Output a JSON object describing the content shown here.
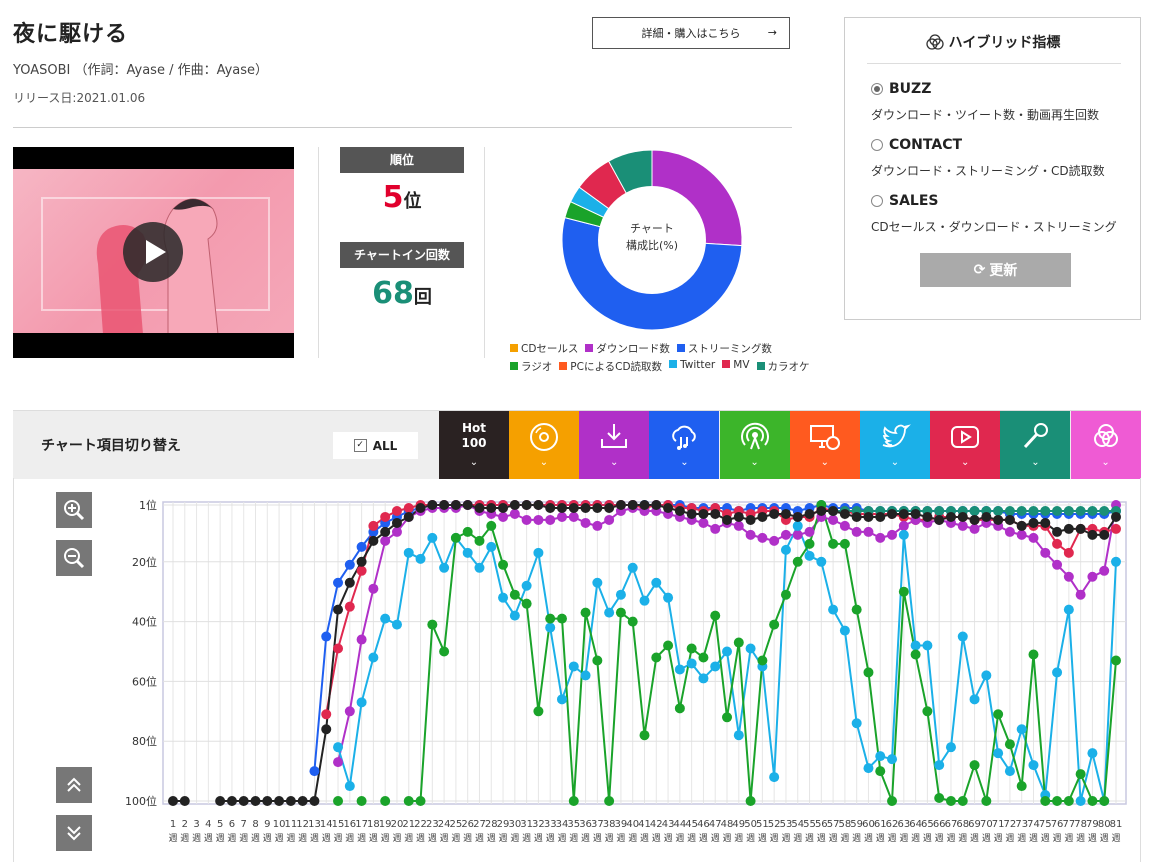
{
  "song": {
    "title": "夜に駆ける",
    "artist": "YOASOBI （作詞：Ayase / 作曲：Ayase）",
    "release": "リリース日:2021.01.06",
    "detail_button": "詳細・購入はこちら",
    "detail_arrow": "→"
  },
  "stats": {
    "rank_label": "順位",
    "rank_value": "5",
    "rank_suffix": "位",
    "chartin_label": "チャートイン回数",
    "chartin_value": "68",
    "chartin_suffix": "回"
  },
  "donut": {
    "center_line1": "チャート",
    "center_line2": "構成比(%)",
    "legend_row1": [
      {
        "label": "CDセールス",
        "color": "#f5a000"
      },
      {
        "label": "ダウンロード数",
        "color": "#b030c8"
      },
      {
        "label": "ストリーミング数",
        "color": "#1f5ff0"
      }
    ],
    "legend_row2": [
      {
        "label": "ラジオ",
        "color": "#1aa32a"
      },
      {
        "label": "PCによるCD読取数",
        "color": "#ff5a1f"
      },
      {
        "label": "Twitter",
        "color": "#1bb0e8"
      },
      {
        "label": "MV",
        "color": "#e0284f"
      },
      {
        "label": "カラオケ",
        "color": "#1a8f77"
      }
    ],
    "slices": [
      {
        "name": "ダウンロード数",
        "value": 26,
        "color": "#b030c8"
      },
      {
        "name": "ストリーミング数",
        "value": 53,
        "color": "#1f5ff0"
      },
      {
        "name": "ラジオ",
        "value": 3,
        "color": "#1aa32a"
      },
      {
        "name": "Twitter",
        "value": 3,
        "color": "#1bb0e8"
      },
      {
        "name": "MV",
        "value": 7,
        "color": "#e0284f"
      },
      {
        "name": "カラオケ",
        "value": 8,
        "color": "#1a8f77"
      }
    ]
  },
  "hybrid": {
    "title": "ハイブリッド指標",
    "options": [
      {
        "label": "BUZZ",
        "desc": "ダウンロード・ツイート数・動画再生回数",
        "selected": true
      },
      {
        "label": "CONTACT",
        "desc": "ダウンロード・ストリーミング・CD読取数",
        "selected": false
      },
      {
        "label": "SALES",
        "desc": "CDセールス・ダウンロード・ストリーミング",
        "selected": false
      }
    ],
    "refresh": "更新"
  },
  "switcher": {
    "title": "チャート項目切り替え",
    "all": "ALL",
    "hot_line1": "Hot",
    "hot_line2": "100",
    "tabs": [
      {
        "icon": "cd-icon",
        "color": "#f5a000"
      },
      {
        "icon": "download-icon",
        "color": "#b030c8"
      },
      {
        "icon": "streaming-icon",
        "color": "#1f5ff0"
      },
      {
        "icon": "radio-icon",
        "color": "#3cb52a"
      },
      {
        "icon": "pc-cd-icon",
        "color": "#ff5a1f"
      },
      {
        "icon": "twitter-icon",
        "color": "#1bb0e8"
      },
      {
        "icon": "video-icon",
        "color": "#e0284f"
      },
      {
        "icon": "karaoke-icon",
        "color": "#1a8f77"
      },
      {
        "icon": "hybrid-icon",
        "color": "#ef5bd4"
      }
    ]
  },
  "chart_data": {
    "type": "line",
    "ylabels": [
      "1位",
      "20位",
      "40位",
      "60位",
      "80位",
      "100位"
    ],
    "yticks": [
      1,
      20,
      40,
      60,
      80,
      100
    ],
    "ylim": [
      1,
      100
    ],
    "x_suffix": "週",
    "x": [
      1,
      2,
      3,
      4,
      5,
      6,
      7,
      8,
      9,
      10,
      11,
      12,
      13,
      14,
      15,
      16,
      17,
      18,
      19,
      20,
      21,
      22,
      23,
      24,
      25,
      26,
      27,
      28,
      29,
      30,
      31,
      32,
      33,
      34,
      35,
      36,
      37,
      38,
      39,
      40,
      41,
      42,
      43,
      44,
      45,
      46,
      47,
      48,
      49,
      50,
      51,
      52,
      53,
      54,
      55,
      56,
      57,
      58,
      59,
      60,
      61,
      62,
      63,
      64,
      65,
      66,
      67,
      68,
      69,
      70,
      71,
      72,
      73,
      74,
      75,
      76,
      77,
      78,
      79,
      80,
      81
    ],
    "series": [
      {
        "color": "#1f5ff0",
        "values": [
          null,
          null,
          null,
          null,
          null,
          null,
          null,
          null,
          null,
          null,
          null,
          null,
          90,
          45,
          27,
          21,
          15,
          10,
          7,
          5,
          3,
          2,
          1,
          1,
          1,
          1,
          1,
          1,
          1,
          1,
          1,
          1,
          1,
          1,
          1,
          1,
          1,
          1,
          1,
          1,
          1,
          1,
          1,
          1,
          2,
          2,
          2,
          2,
          3,
          2,
          2,
          2,
          2,
          3,
          2,
          1,
          2,
          2,
          2,
          3,
          3,
          3,
          3,
          3,
          3,
          3,
          3,
          3,
          3,
          3,
          3,
          4,
          4,
          4,
          4,
          4,
          4,
          4,
          4,
          4,
          3
        ]
      },
      {
        "color": "#e0284f",
        "values": [
          null,
          null,
          null,
          null,
          null,
          null,
          null,
          null,
          null,
          null,
          null,
          null,
          null,
          71,
          49,
          35,
          23,
          8,
          5,
          3,
          2,
          1,
          1,
          1,
          1,
          1,
          1,
          1,
          1,
          1,
          1,
          1,
          1,
          1,
          1,
          1,
          1,
          1,
          1,
          1,
          2,
          1,
          1,
          2,
          2,
          3,
          2,
          4,
          3,
          4,
          3,
          3,
          6,
          5,
          5,
          2,
          3,
          3,
          4,
          4,
          4,
          4,
          5,
          6,
          6,
          5,
          5,
          5,
          6,
          6,
          6,
          6,
          8,
          8,
          8,
          14,
          17,
          9,
          9,
          10,
          9
        ]
      },
      {
        "color": "#b030c8",
        "values": [
          null,
          null,
          null,
          null,
          null,
          null,
          null,
          null,
          null,
          null,
          null,
          null,
          null,
          null,
          87,
          70,
          46,
          29,
          13,
          10,
          5,
          3,
          2,
          2,
          2,
          1,
          3,
          4,
          5,
          4,
          6,
          6,
          6,
          5,
          5,
          7,
          8,
          6,
          3,
          2,
          3,
          3,
          4,
          5,
          6,
          7,
          9,
          7,
          8,
          11,
          12,
          13,
          11,
          11,
          10,
          5,
          6,
          8,
          10,
          10,
          12,
          11,
          8,
          6,
          7,
          6,
          7,
          8,
          9,
          7,
          8,
          10,
          11,
          12,
          17,
          21,
          25,
          31,
          25,
          23,
          1
        ]
      },
      {
        "color": "#1bb0e8",
        "values": [
          null,
          null,
          null,
          null,
          null,
          null,
          null,
          null,
          null,
          null,
          null,
          null,
          null,
          null,
          82,
          95,
          67,
          52,
          39,
          41,
          17,
          19,
          12,
          22,
          12,
          17,
          22,
          15,
          32,
          38,
          28,
          17,
          42,
          66,
          55,
          58,
          27,
          37,
          31,
          22,
          33,
          27,
          32,
          56,
          54,
          59,
          55,
          50,
          78,
          49,
          55,
          92,
          16,
          8,
          18,
          20,
          36,
          43,
          74,
          89,
          85,
          86,
          11,
          48,
          48,
          88,
          82,
          45,
          66,
          58,
          84,
          90,
          76,
          88,
          98,
          57,
          36,
          100,
          84,
          100,
          20
        ]
      },
      {
        "color": "#1aa32a",
        "values": [
          null,
          null,
          null,
          null,
          null,
          null,
          null,
          null,
          null,
          null,
          null,
          null,
          null,
          null,
          100,
          null,
          100,
          null,
          100,
          null,
          100,
          100,
          41,
          50,
          12,
          10,
          13,
          8,
          21,
          31,
          34,
          70,
          39,
          39,
          100,
          37,
          53,
          100,
          37,
          40,
          78,
          52,
          48,
          69,
          49,
          52,
          38,
          72,
          47,
          100,
          53,
          41,
          31,
          20,
          14,
          1,
          14,
          14,
          36,
          57,
          90,
          100,
          30,
          51,
          70,
          99,
          100,
          100,
          88,
          100,
          71,
          81,
          95,
          51,
          100,
          100,
          100,
          91,
          100,
          100,
          53
        ]
      },
      {
        "color": "#1a8f77",
        "values": [
          null,
          null,
          null,
          null,
          null,
          null,
          null,
          null,
          null,
          null,
          null,
          null,
          null,
          null,
          null,
          null,
          null,
          null,
          null,
          null,
          null,
          null,
          null,
          null,
          null,
          null,
          null,
          null,
          null,
          null,
          null,
          null,
          null,
          null,
          null,
          null,
          null,
          null,
          null,
          null,
          null,
          null,
          null,
          null,
          null,
          null,
          null,
          null,
          null,
          null,
          null,
          null,
          null,
          null,
          null,
          null,
          3,
          3,
          3,
          3,
          3,
          3,
          3,
          3,
          3,
          3,
          3,
          3,
          3,
          3,
          3,
          3,
          3,
          3,
          3,
          3,
          3,
          3,
          3,
          3,
          3
        ]
      },
      {
        "color": "#222222",
        "values": [
          100,
          100,
          null,
          null,
          100,
          100,
          100,
          100,
          100,
          100,
          100,
          100,
          100,
          76,
          36,
          27,
          20,
          13,
          10,
          7,
          5,
          2,
          1,
          1,
          1,
          1,
          2,
          2,
          2,
          1,
          1,
          1,
          2,
          2,
          2,
          2,
          2,
          2,
          1,
          1,
          1,
          1,
          2,
          3,
          4,
          4,
          4,
          6,
          5,
          6,
          5,
          4,
          4,
          5,
          4,
          3,
          3,
          4,
          5,
          5,
          5,
          4,
          4,
          4,
          5,
          6,
          5,
          5,
          6,
          5,
          6,
          6,
          8,
          7,
          7,
          10,
          9,
          9,
          11,
          11,
          5
        ]
      }
    ]
  }
}
